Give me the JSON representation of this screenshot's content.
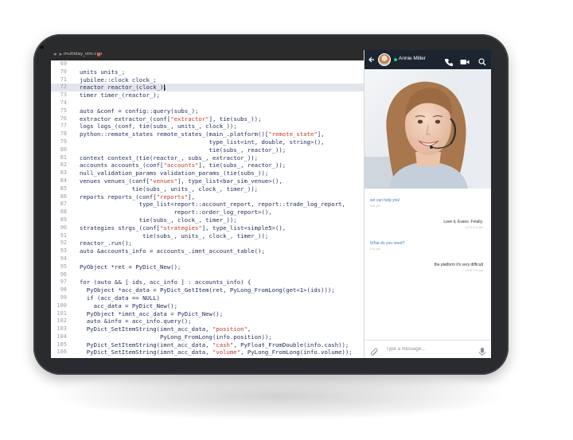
{
  "editor": {
    "file_tab": "multiday_sim.cpp",
    "lines": [
      {
        "num": "69",
        "text": ""
      },
      {
        "num": "70",
        "text": "units units_;"
      },
      {
        "num": "71",
        "text": "jubilee::clock clock_;"
      },
      {
        "num": "72",
        "text": "reactor reactor_(clock_);"
      },
      {
        "num": "73",
        "text": "timer timer_(reactor_);"
      },
      {
        "num": "74",
        "text": ""
      },
      {
        "num": "75",
        "text": "auto &conf = config::query(subs_);"
      },
      {
        "num": "76",
        "text": "extractor extractor_(conf[\"extractor\"], tie(subs_));"
      },
      {
        "num": "77",
        "text": "logs logs_(conf, tie(subs_, units_, clock_));"
      },
      {
        "num": "78",
        "text": "python::remote_states remote_states_(main_.platform()[\"remote_state\"],"
      },
      {
        "num": "79",
        "text": "                                     type_list<int, double, string>(),"
      },
      {
        "num": "80",
        "text": "                                     tie(subs_, reactor_));"
      },
      {
        "num": "81",
        "text": "context context_(tie(reactor_, subs_, extractor_));"
      },
      {
        "num": "82",
        "text": "accounts accounts_(conf[\"accounts\"], tie(subs_, reactor_));"
      },
      {
        "num": "83",
        "text": "null_validation_params validation_params_(tie(subs_));"
      },
      {
        "num": "84",
        "text": "venues venues_(conf[\"venues\"], type_list<bar_sim_venue>(),"
      },
      {
        "num": "85",
        "text": "               tie(subs_, units_, clock_, timer_));"
      },
      {
        "num": "86",
        "text": "reports reports_(conf[\"reports\"],"
      },
      {
        "num": "87",
        "text": "                 type_list<report::account_report, report::trade_log_report,"
      },
      {
        "num": "88",
        "text": "                           report::order_log_report>(),"
      },
      {
        "num": "89",
        "text": "                 tie(subs_, clock_, timer_));"
      },
      {
        "num": "90",
        "text": "strategies strgs_(conf[\"strategies\"], type_list<simple5>(),"
      },
      {
        "num": "91",
        "text": "                  tie(subs_, units_, clock_, timer_));"
      },
      {
        "num": "92",
        "text": "reactor_.run();"
      },
      {
        "num": "93",
        "text": "auto &accounts_info = accounts_.imnt_account_table();"
      },
      {
        "num": "94",
        "text": ""
      },
      {
        "num": "95",
        "text": "PyObject *ret = PyDict_New();"
      },
      {
        "num": "96",
        "text": ""
      },
      {
        "num": "97",
        "text": "for (auto && [ ids, acc_info ] : accounts_info) {"
      },
      {
        "num": "98",
        "text": "  PyObject *acc_data = PyDict_GetItem(ret, PyLong_FromLong(get<1>(ids)));"
      },
      {
        "num": "99",
        "text": "  if (acc_data == NULL)"
      },
      {
        "num": "100",
        "text": "    acc_data = PyDict_New();"
      },
      {
        "num": "101",
        "text": "  PyObject *imnt_acc_data = PyDict_New();"
      },
      {
        "num": "102",
        "text": "  auto &info = acc_info.query();"
      },
      {
        "num": "103",
        "text": "  PyDict_SetItemString(imnt_acc_data, \"position\","
      },
      {
        "num": "104",
        "text": "                       PyLong_FromLong(info.position));"
      },
      {
        "num": "105",
        "text": "  PyDict_SetItemString(imnt_acc_data, \"cash\", PyFloat_FromDouble(info.cash));"
      },
      {
        "num": "106",
        "text": "  PyDict_SetItemString(imnt_acc_data, \"volume\", PyLong_FromLong(info.volume));"
      }
    ]
  },
  "chat": {
    "contact_name": "Annie Miller",
    "messages": [
      {
        "dir": "in",
        "text": "we can help you!",
        "time": "9:41 pm"
      },
      {
        "dir": "out",
        "text": "Love it, Evans. Finally.",
        "time": "12:10 9:41 pm"
      },
      {
        "dir": "in",
        "text": "What do you need?",
        "time": "9:41 pm"
      },
      {
        "dir": "out",
        "text": "the platform it's very difficult",
        "time": "12:10 9:41 pm"
      }
    ],
    "compose_placeholder": "Type a message..."
  },
  "colors": {
    "header_bg": "#1d2431",
    "incoming_text": "#3d7cc9",
    "string_literal": "#c0392b",
    "online": "#2ecc71"
  },
  "icons": [
    "back-arrow-icon",
    "phone-icon",
    "video-camera-icon",
    "search-icon",
    "paperclip-icon",
    "microphone-icon"
  ]
}
